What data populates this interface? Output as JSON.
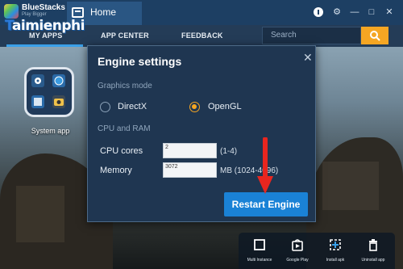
{
  "app": {
    "brand": "BlueStacks",
    "brand_sub": "Play Bigger",
    "tab_title": "Home",
    "watermark": "Taimienphi"
  },
  "nav": {
    "items": [
      "MY APPS",
      "APP CENTER",
      "FEEDBACK"
    ],
    "search_placeholder": "Search",
    "accent": "#3aa0e8",
    "search_button_color": "#f5a623"
  },
  "desktop": {
    "system_app_label": "System app"
  },
  "dialog": {
    "title": "Engine settings",
    "close_icon": "close-icon",
    "graphics_mode_label": "Graphics mode",
    "graphics_options": [
      {
        "label": "DirectX",
        "selected": false
      },
      {
        "label": "OpenGL",
        "selected": true
      }
    ],
    "cpu_ram_label": "CPU and RAM",
    "cpu_cores_label": "CPU cores",
    "cpu_cores_value": "2",
    "cpu_cores_hint": "(1-4)",
    "memory_label": "Memory",
    "memory_value": "3072",
    "memory_hint": "MB (1024-4096)",
    "restart_button": "Restart Engine",
    "button_color": "#1a82d6"
  },
  "dock": {
    "items": [
      {
        "label": "Multi Instance",
        "icon": "multi-instance-icon"
      },
      {
        "label": "Google Play",
        "icon": "google-play-icon"
      },
      {
        "label": "Install apk",
        "icon": "install-apk-icon"
      },
      {
        "label": "Uninstall app",
        "icon": "trash-icon"
      }
    ]
  }
}
